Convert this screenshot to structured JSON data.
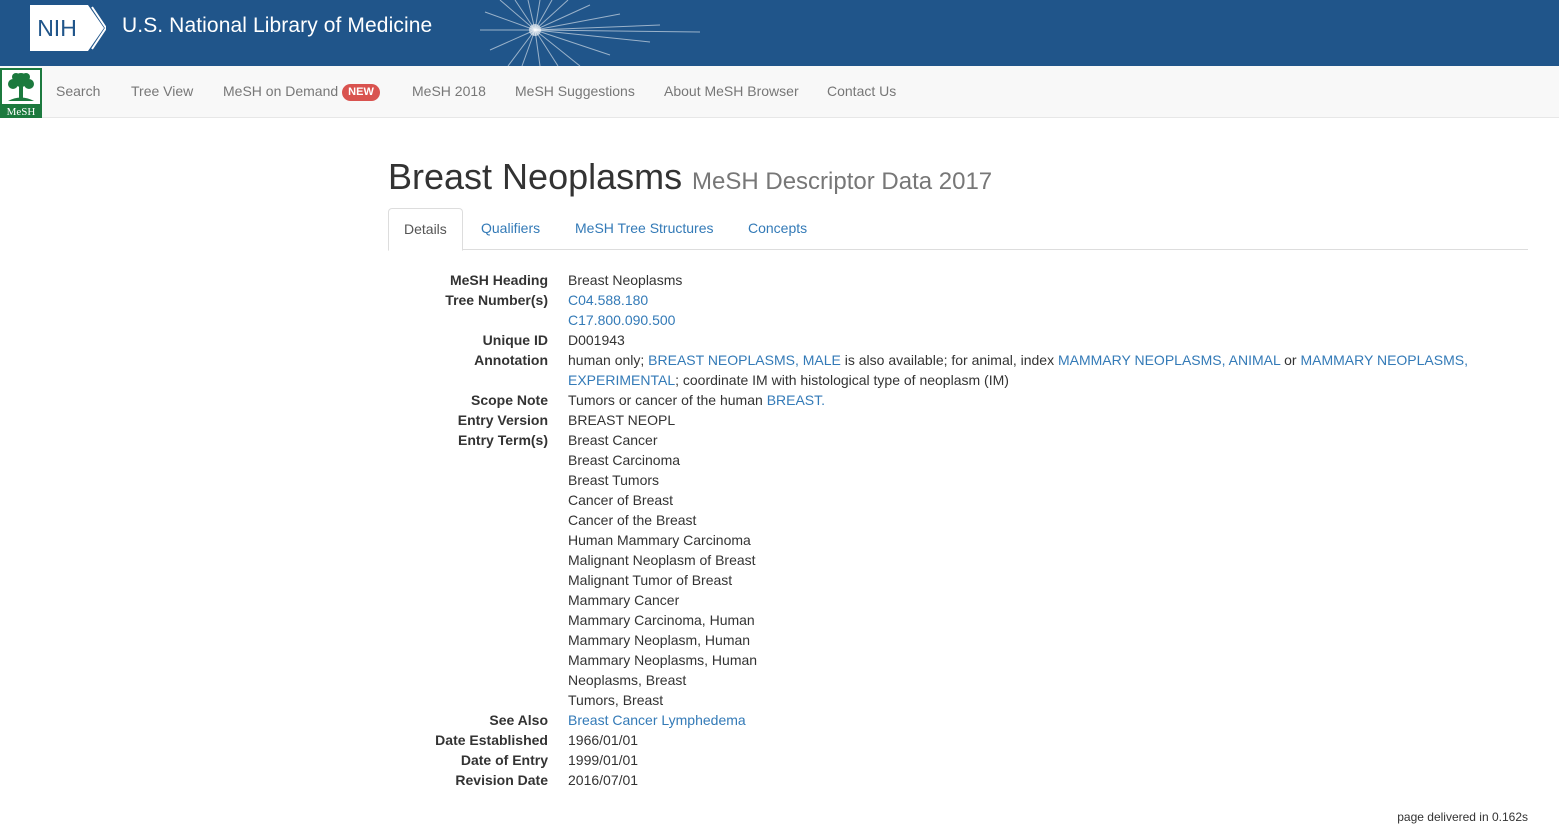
{
  "banner": {
    "logo_text": "NIH",
    "title": "U.S. National Library of Medicine",
    "bg_color": "#20558a"
  },
  "nav": {
    "logo_text": "MeSH",
    "items": [
      {
        "label": "Search"
      },
      {
        "label": "Tree View"
      },
      {
        "label": "MeSH on Demand",
        "badge": "NEW"
      },
      {
        "label": "MeSH 2018"
      },
      {
        "label": "MeSH Suggestions"
      },
      {
        "label": "About MeSH Browser"
      },
      {
        "label": "Contact Us"
      }
    ]
  },
  "page": {
    "title": "Breast Neoplasms",
    "subtitle": "MeSH Descriptor Data 2017"
  },
  "tabs": [
    {
      "label": "Details",
      "active": true
    },
    {
      "label": "Qualifiers"
    },
    {
      "label": "MeSH Tree Structures"
    },
    {
      "label": "Concepts"
    }
  ],
  "details": {
    "heading": {
      "label": "MeSH Heading",
      "value": "Breast Neoplasms"
    },
    "tree_numbers": {
      "label": "Tree Number(s)",
      "values": [
        "C04.588.180",
        "C17.800.090.500"
      ]
    },
    "unique_id": {
      "label": "Unique ID",
      "value": "D001943"
    },
    "annotation": {
      "label": "Annotation",
      "t1": "human only; ",
      "link1": "BREAST NEOPLASMS, MALE",
      "t2": " is also available; for animal, index ",
      "link2": "MAMMARY NEOPLASMS, ANIMAL",
      "t3": " or ",
      "link3": "MAMMARY NEOPLASMS, EXPERIMENTAL",
      "t4": "; coordinate IM with histological type of neoplasm (IM)"
    },
    "scope_note": {
      "label": "Scope Note",
      "text": "Tumors or cancer of the human ",
      "link": "BREAST."
    },
    "entry_version": {
      "label": "Entry Version",
      "value": "BREAST NEOPL"
    },
    "entry_terms": {
      "label": "Entry Term(s)",
      "values": [
        "Breast Cancer",
        "Breast Carcinoma",
        "Breast Tumors",
        "Cancer of Breast",
        "Cancer of the Breast",
        "Human Mammary Carcinoma",
        "Malignant Neoplasm of Breast",
        "Malignant Tumor of Breast",
        "Mammary Cancer",
        "Mammary Carcinoma, Human",
        "Mammary Neoplasm, Human",
        "Mammary Neoplasms, Human",
        "Neoplasms, Breast",
        "Tumors, Breast"
      ]
    },
    "see_also": {
      "label": "See Also",
      "value": "Breast Cancer Lymphedema"
    },
    "date_established": {
      "label": "Date Established",
      "value": "1966/01/01"
    },
    "date_of_entry": {
      "label": "Date of Entry",
      "value": "1999/01/01"
    },
    "revision_date": {
      "label": "Revision Date",
      "value": "2016/07/01"
    }
  },
  "footer": {
    "text": "page delivered in 0.162s"
  },
  "colors": {
    "link": "#337ab7",
    "badge": "#d9534f",
    "mesh_green": "#1c7a3e"
  }
}
